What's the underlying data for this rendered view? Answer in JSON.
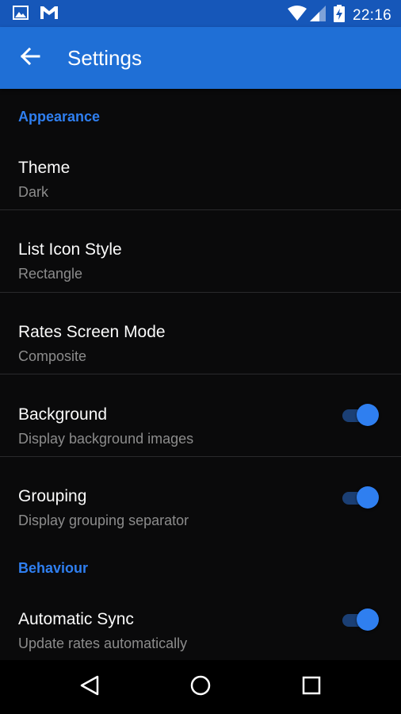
{
  "status_bar": {
    "time": "22:16",
    "icons": [
      "image-icon",
      "gmail-icon",
      "wifi-icon",
      "cell-signal-icon",
      "battery-charging-icon"
    ]
  },
  "app_bar": {
    "title": "Settings",
    "back_icon": "arrow-back-icon"
  },
  "sections": [
    {
      "header": "Appearance",
      "items": [
        {
          "title": "Theme",
          "subtitle": "Dark"
        },
        {
          "title": "List Icon Style",
          "subtitle": "Rectangle"
        },
        {
          "title": "Rates Screen Mode",
          "subtitle": "Composite"
        },
        {
          "title": "Background",
          "subtitle": "Display background images",
          "toggle": true
        },
        {
          "title": "Grouping",
          "subtitle": "Display grouping separator",
          "toggle": true
        }
      ]
    },
    {
      "header": "Behaviour",
      "items": [
        {
          "title": "Automatic Sync",
          "subtitle": "Update rates automatically",
          "toggle": true
        }
      ]
    }
  ],
  "nav_bar": {
    "icons": [
      "back-triangle-icon",
      "home-circle-icon",
      "recents-square-icon"
    ]
  },
  "colors": {
    "status_bar": "#1657b9",
    "app_bar": "#1f6fd6",
    "accent": "#2f7ff0",
    "background": "#0a0a0b"
  }
}
